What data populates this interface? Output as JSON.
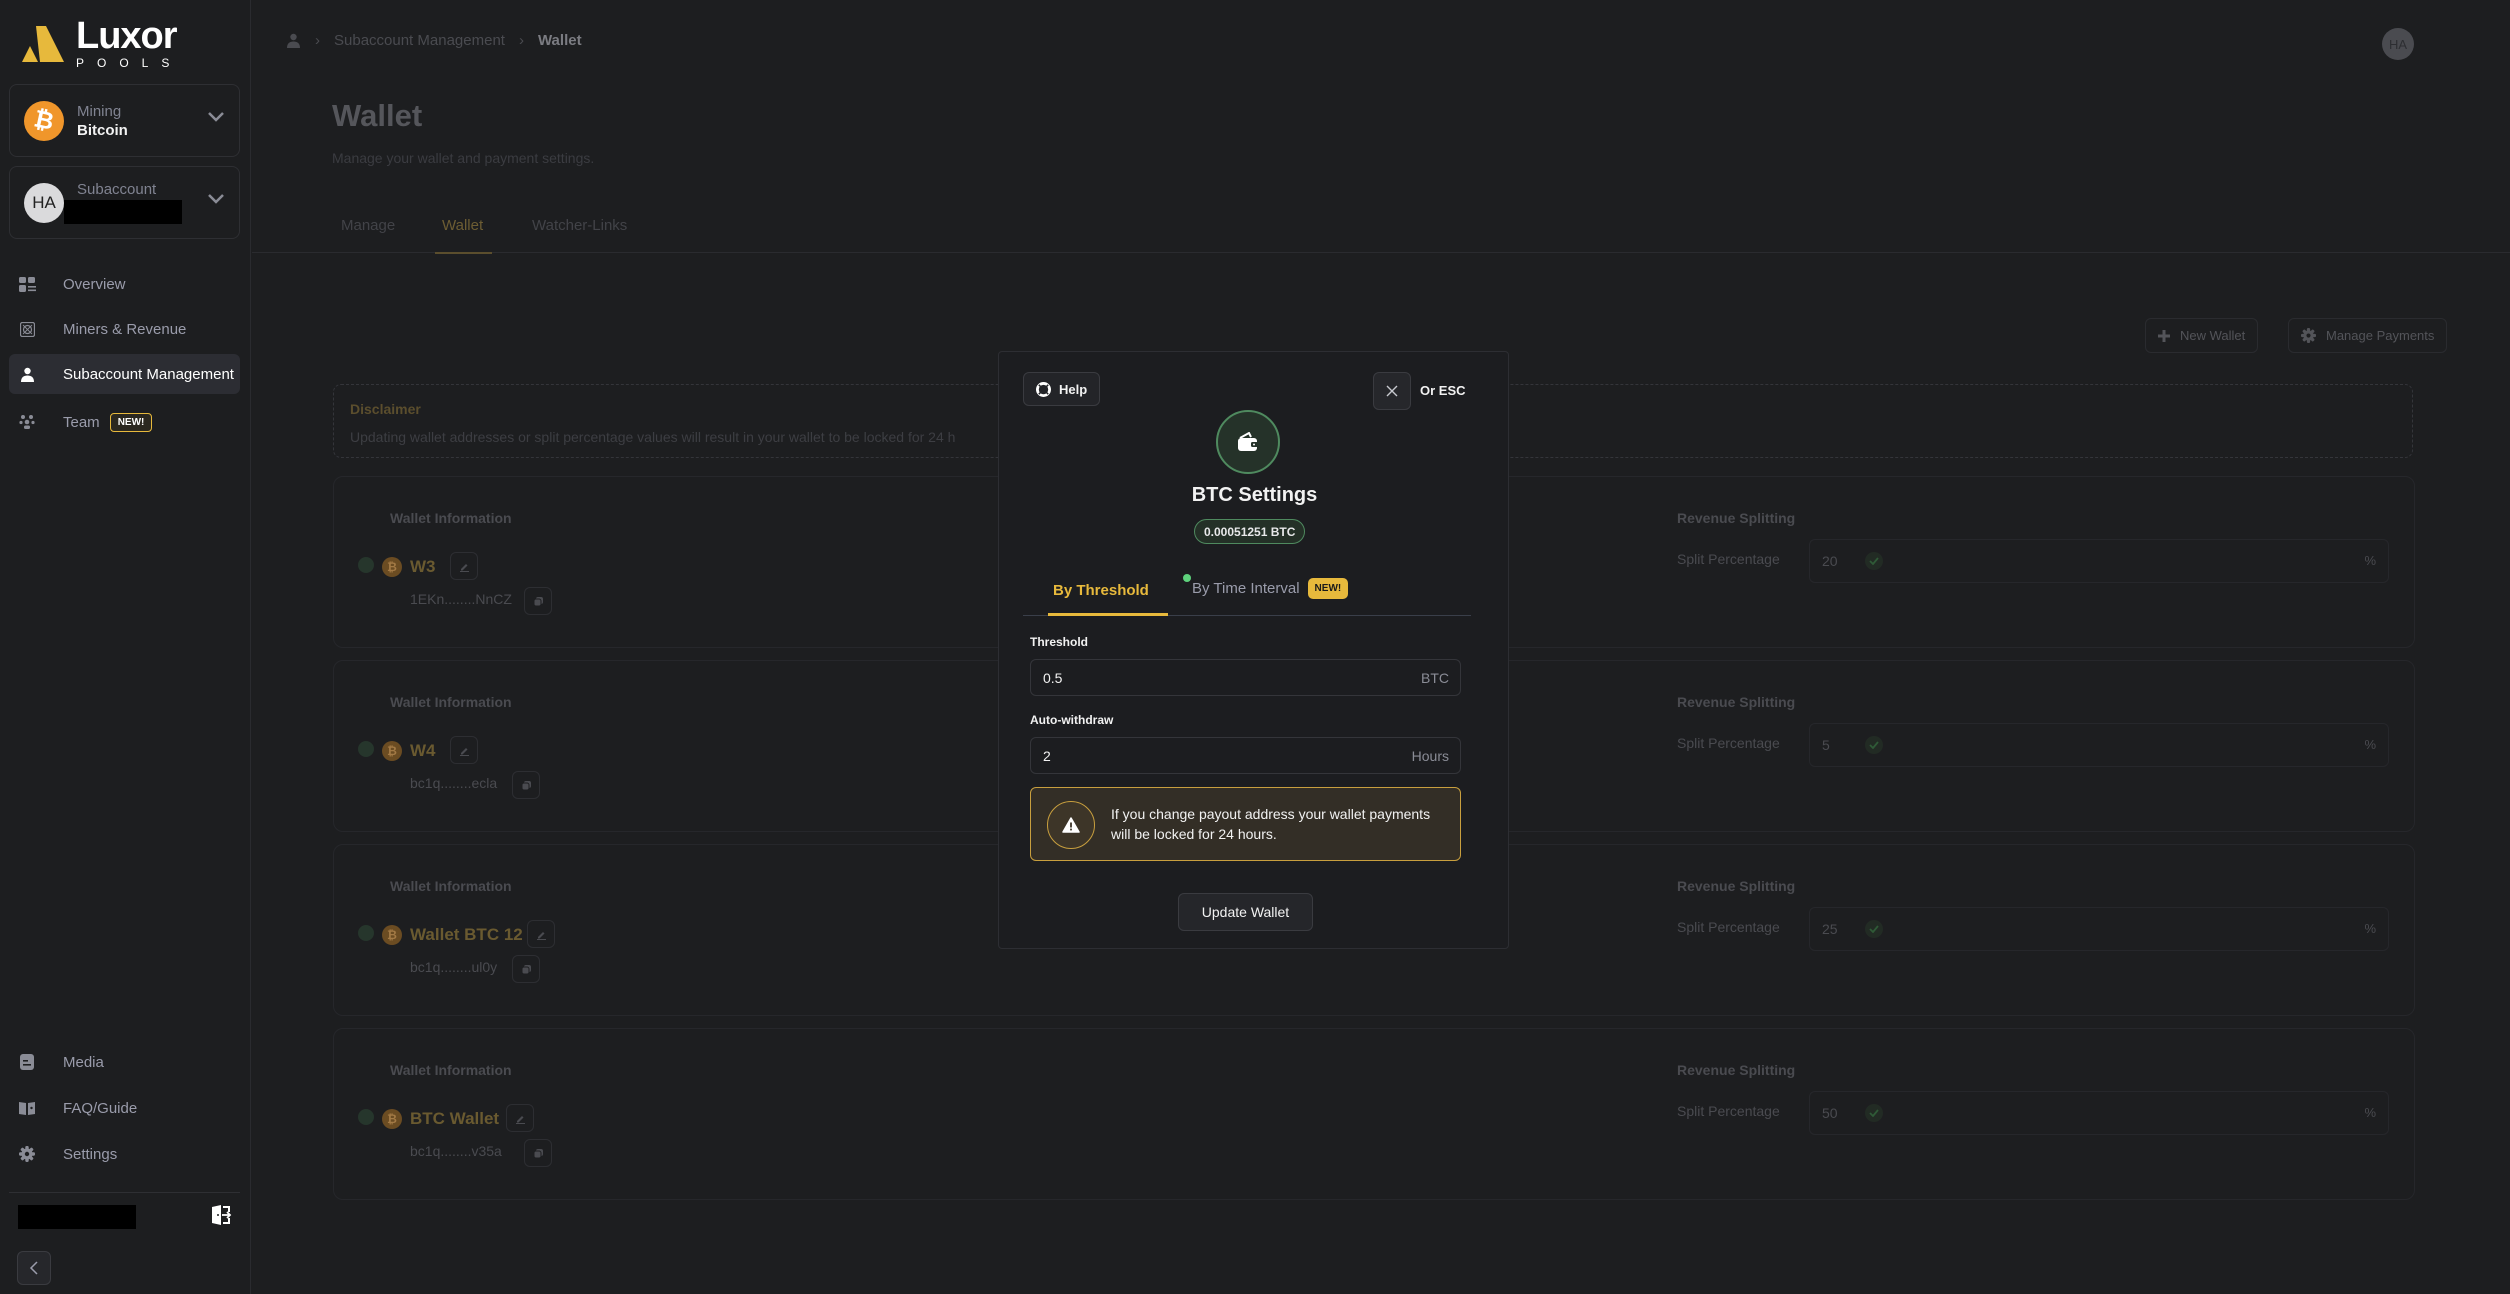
{
  "brand": {
    "name": "Luxor",
    "sub": "POOLS",
    "accent": "#e7b93c"
  },
  "sidebar": {
    "mining_selector": {
      "label": "Mining",
      "value": "Bitcoin"
    },
    "subaccount_selector": {
      "label": "Subaccount",
      "avatar_initials": "HA"
    },
    "items": [
      {
        "label": "Overview",
        "icon": "overview-icon"
      },
      {
        "label": "Miners & Revenue",
        "icon": "miners-icon"
      },
      {
        "label": "Subaccount Management",
        "icon": "user-icon",
        "active": true
      },
      {
        "label": "Team",
        "icon": "team-icon",
        "badge": "NEW!"
      }
    ],
    "bottom_items": [
      {
        "label": "Media",
        "icon": "media-icon"
      },
      {
        "label": "FAQ/Guide",
        "icon": "book-icon"
      },
      {
        "label": "Settings",
        "icon": "gear-icon"
      }
    ]
  },
  "header": {
    "breadcrumb": [
      "Subaccount Management",
      "Wallet"
    ],
    "avatar_initials": "HA"
  },
  "page": {
    "title": "Wallet",
    "subtitle": "Manage your wallet and payment settings.",
    "tabs": [
      {
        "label": "Manage"
      },
      {
        "label": "Wallet",
        "active": true
      },
      {
        "label": "Watcher-Links"
      }
    ],
    "actions": {
      "new_wallet": "New Wallet",
      "manage_payments": "Manage Payments"
    },
    "disclaimer": {
      "title": "Disclaimer",
      "text": "Updating wallet addresses or split percentage values will result in your wallet to be locked for 24 h"
    },
    "wallets": [
      {
        "section": "Wallet Information",
        "name": "W3",
        "address": "1EKn........NnCZ",
        "split_section": "Revenue Splitting",
        "split_label": "Split Percentage",
        "split": "20",
        "unit": "%"
      },
      {
        "section": "Wallet Information",
        "name": "W4",
        "address": "bc1q........ecla",
        "split_section": "Revenue Splitting",
        "split_label": "Split Percentage",
        "split": "5",
        "unit": "%"
      },
      {
        "section": "Wallet Information",
        "name": "Wallet BTC 12",
        "address": "bc1q........ul0y",
        "split_section": "Revenue Splitting",
        "split_label": "Split Percentage",
        "split": "25",
        "unit": "%"
      },
      {
        "section": "Wallet Information",
        "name": "BTC Wallet",
        "address": "bc1q........v35a",
        "split_section": "Revenue Splitting",
        "split_label": "Split Percentage",
        "split": "50",
        "unit": "%"
      }
    ]
  },
  "modal": {
    "help_label": "Help",
    "esc_label": "Or ESC",
    "title": "BTC Settings",
    "balance": "0.00051251 BTC",
    "tabs": {
      "threshold": "By Threshold",
      "interval": "By Time Interval",
      "interval_badge": "NEW!"
    },
    "threshold": {
      "label": "Threshold",
      "value": "0.5",
      "unit": "BTC"
    },
    "auto_withdraw": {
      "label": "Auto-withdraw",
      "value": "2",
      "unit": "Hours"
    },
    "warning": "If you change payout address your wallet payments will be locked for 24 hours.",
    "submit_label": "Update Wallet"
  }
}
